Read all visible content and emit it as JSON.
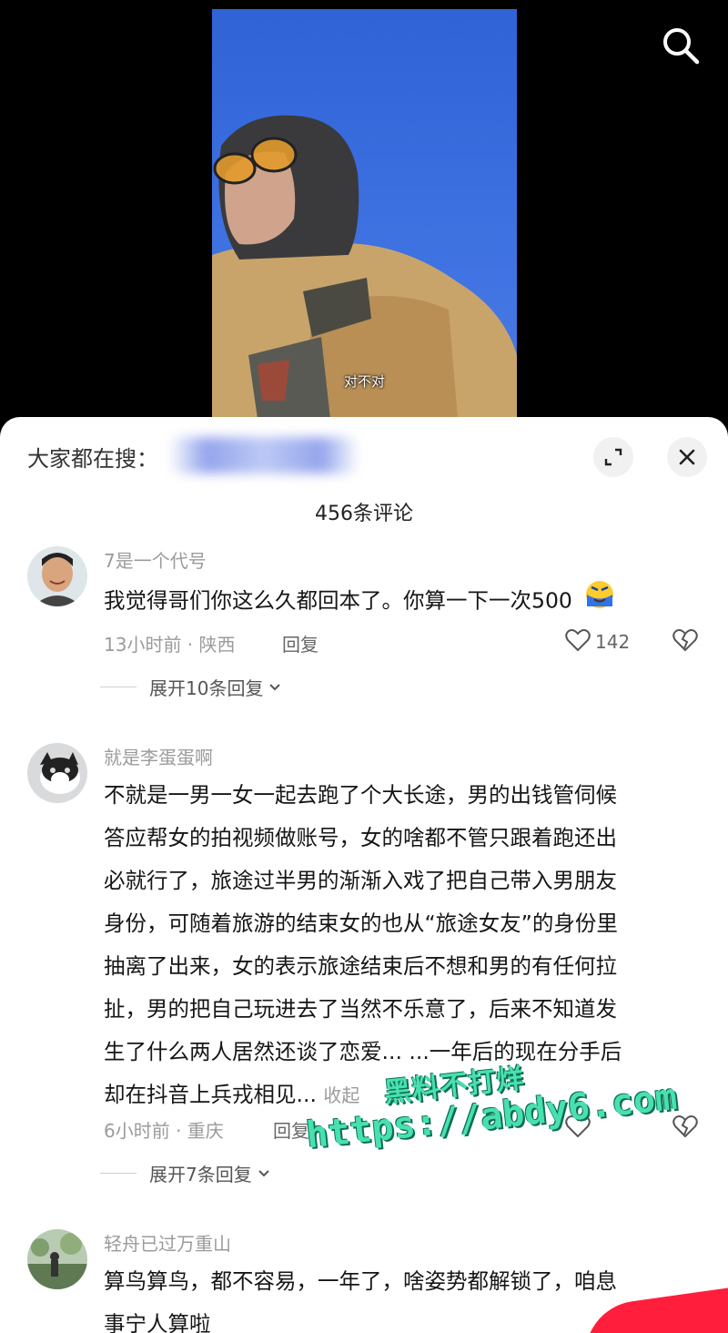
{
  "video": {
    "subtitle": "对不对"
  },
  "top_bar": {
    "search_icon": "search-icon"
  },
  "panel": {
    "search_prefix": "大家都在搜：",
    "expand_icon": "expand-icon",
    "close_icon": "close-icon",
    "comment_count": "456条评论"
  },
  "comments": [
    {
      "username": "7是一个代号",
      "text": "我觉得哥们你这么久都回本了。你算一下一次500",
      "emoji": "crying-laugh-emoji",
      "time_location": "13小时前 · 陕西",
      "reply_label": "回复",
      "likes": "142",
      "expand_label": "展开10条回复"
    },
    {
      "username": "就是李蛋蛋啊",
      "text_lines": [
        "不就是一男一女一起去跑了个大长途，男的出钱管伺候",
        "答应帮女的拍视频做账号，女的啥都不管只跟着跑还出",
        "必就行了，旅途过半男的渐渐入戏了把自己带入男朋友",
        "身份，可随着旅游的结束女的也从“旅途女友”的身份里",
        "抽离了出来，女的表示旅途结束后不想和男的有任何拉",
        "扯，男的把自己玩进去了当然不乐意了，后来不知道发",
        "生了什么两人居然还谈了恋爱... ...一年后的现在分手后",
        "却在抖音上兵戎相见..."
      ],
      "collapse_label": "收起",
      "time_location": "6小时前 · 重庆",
      "reply_label": "回复",
      "expand_label": "展开7条回复"
    },
    {
      "username": "轻舟已过万重山",
      "text_lines": [
        "算鸟算鸟，都不容易，一年了，啥姿势都解锁了，咱息",
        "事宁人算啦"
      ]
    }
  ],
  "watermark": {
    "line1": "黑料不打烊",
    "line2": "https://abdy6.com"
  }
}
